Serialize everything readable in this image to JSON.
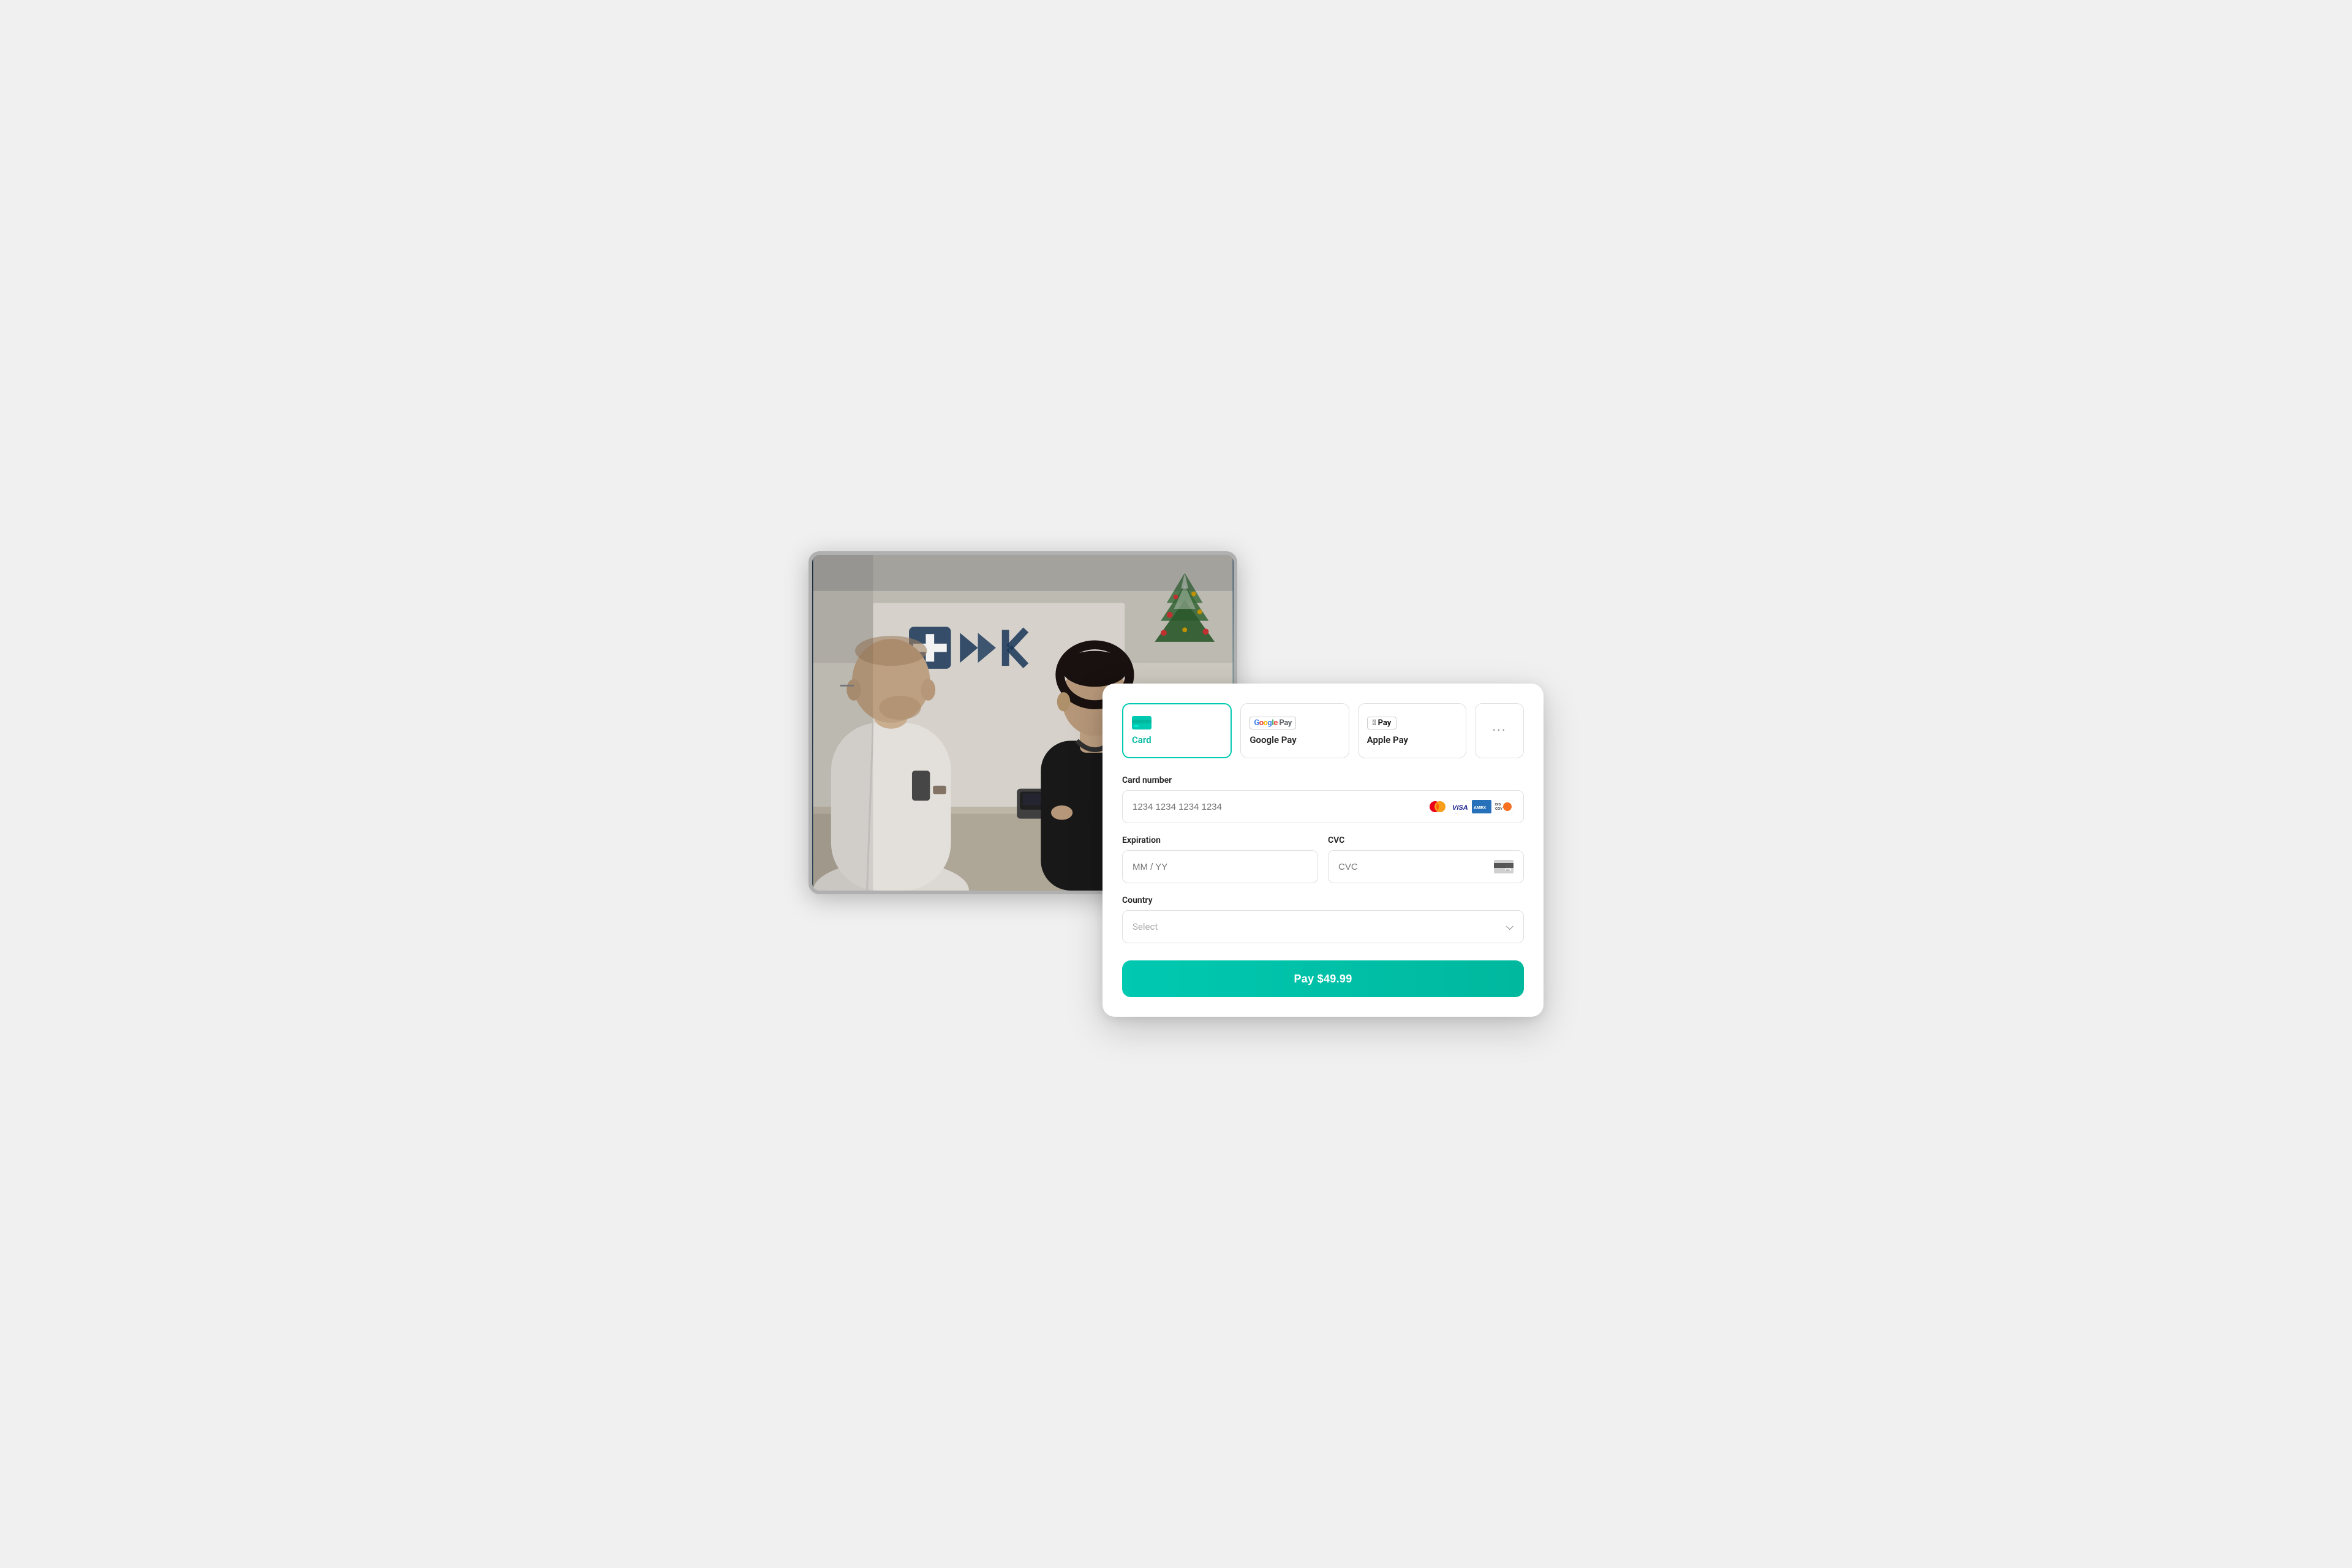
{
  "photo": {
    "alt": "Office payment scene with two people at a counter"
  },
  "payment": {
    "methods": [
      {
        "id": "card",
        "label": "Card",
        "active": true
      },
      {
        "id": "google-pay",
        "label": "Google Pay",
        "active": false
      },
      {
        "id": "apple-pay",
        "label": "Apple Pay",
        "active": false
      },
      {
        "id": "more",
        "label": "···",
        "active": false
      }
    ],
    "fields": {
      "card_number": {
        "label": "Card number",
        "placeholder": "1234 1234 1234 1234"
      },
      "expiration": {
        "label": "Expiration",
        "placeholder": "MM / YY"
      },
      "cvc": {
        "label": "CVC",
        "placeholder": "CVC"
      },
      "country": {
        "label": "Country",
        "placeholder": "Select"
      }
    },
    "pay_button": {
      "label": "Pay $49.99"
    },
    "card_brands": [
      "Mastercard",
      "Visa",
      "Amex",
      "Discover"
    ],
    "accent_color": "#00c9b1"
  }
}
